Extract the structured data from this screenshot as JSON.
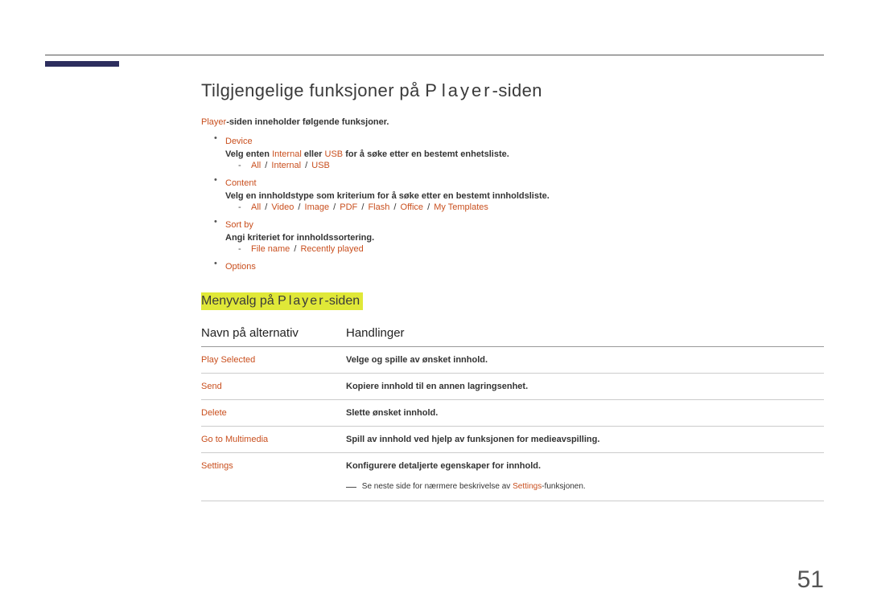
{
  "page_number": "51",
  "title": {
    "prefix": "Tilgjengelige funksjoner på ",
    "p_letter": "P",
    "layer": "layer",
    "suffix": "-siden"
  },
  "intro": {
    "player": "Player",
    "text": "-siden inneholder følgende funksjoner."
  },
  "items": {
    "device": {
      "label": "Device",
      "desc_pre": "Velg enten ",
      "internal": "Internal",
      "desc_mid": " eller ",
      "usb": "USB",
      "desc_post": " for å søke etter en bestemt enhetsliste.",
      "opts": [
        "All",
        "Internal",
        "USB"
      ]
    },
    "content": {
      "label": "Content",
      "desc": "Velg en innholdstype som kriterium for å søke etter en bestemt innholdsliste.",
      "opts": [
        "All",
        "Video",
        "Image",
        "PDF",
        "Flash",
        "Office",
        "My Templates"
      ]
    },
    "sortby": {
      "label": "Sort by",
      "desc": "Angi kriteriet for innholdssortering.",
      "opts": [
        "File name",
        "Recently played"
      ]
    },
    "options": {
      "label": "Options"
    }
  },
  "subsection": {
    "prefix": "Menyvalg på ",
    "p": "P",
    "layer": "layer",
    "suffix": "-siden"
  },
  "table": {
    "headers": [
      "Navn på alternativ",
      "Handlinger"
    ],
    "rows": [
      {
        "name": "Play Selected",
        "action": "Velge og spille av ønsket innhold."
      },
      {
        "name": "Send",
        "action": "Kopiere innhold til en annen lagringsenhet."
      },
      {
        "name": "Delete",
        "action": "Slette ønsket innhold."
      },
      {
        "name": "Go to Multimedia",
        "action": "Spill av innhold ved hjelp av funksjonen for medieavspilling."
      },
      {
        "name": "Settings",
        "action": "Konfigurere detaljerte egenskaper for innhold."
      }
    ],
    "note": {
      "pre": "Se neste side for nærmere beskrivelse av ",
      "settings": "Settings",
      "post": "-funksjonen."
    }
  }
}
